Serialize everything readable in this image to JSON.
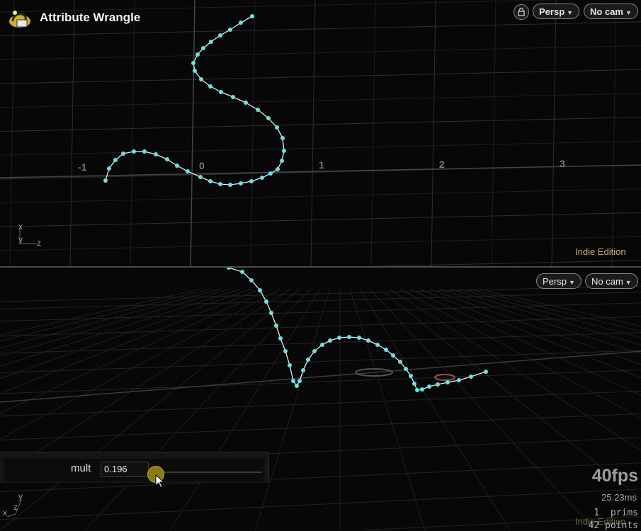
{
  "header": {
    "title": "Attribute Wrangle"
  },
  "top_viewport": {
    "persp_label": "Persp",
    "cam_label": "No cam",
    "edition": "Indie Edition",
    "grid_labels": [
      "-1",
      "0",
      "1",
      "2",
      "3"
    ],
    "gnomon": {
      "x": "x",
      "y": "y",
      "z": "z"
    }
  },
  "bottom_viewport": {
    "persp_label": "Persp",
    "cam_label": "No cam",
    "edition": "Indie Edition",
    "gnomon": {
      "x": "x",
      "y": "y",
      "z": "z"
    }
  },
  "param": {
    "label": "mult",
    "value": "0.196",
    "slider_fraction": 0.06
  },
  "stats": {
    "fps": "40fps",
    "ms": "25.23ms",
    "prims": "1  prims",
    "points": "42 points"
  },
  "colors": {
    "point": "#5fe6e8",
    "edition": "#c8b44a",
    "handle": "#8a7d10"
  },
  "icons": {
    "logo": "houdini-logo-icon",
    "lock": "lock-icon",
    "dropdown": "caret-down-icon",
    "cursor": "mouse-cursor-icon"
  }
}
